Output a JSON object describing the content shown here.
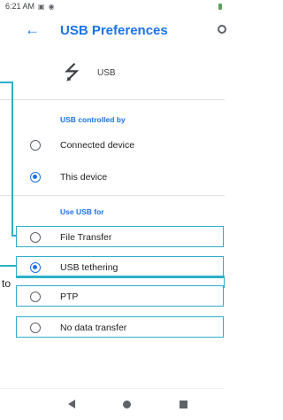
{
  "status": {
    "time": "6:21 AM"
  },
  "header": {
    "title": "USB Preferences"
  },
  "device": {
    "label": "USB"
  },
  "controlled": {
    "title": "USB controlled by",
    "options": [
      {
        "label": "Connected device",
        "checked": false
      },
      {
        "label": "This device",
        "checked": true
      }
    ]
  },
  "use_for": {
    "title": "Use USB for",
    "options": [
      {
        "label": "File Transfer",
        "checked": false
      },
      {
        "label": "USB tethering",
        "checked": true
      },
      {
        "label": "PTP",
        "checked": false
      },
      {
        "label": "No data transfer",
        "checked": false
      }
    ]
  },
  "annotation": {
    "text": "to"
  },
  "colors": {
    "accent": "#1a73e8",
    "highlight": "#2bb0c8"
  },
  "icons": {
    "back": "arrow-left-icon",
    "search": "search-icon",
    "usb": "usb-icon",
    "nav_back": "triangle-back-icon",
    "nav_home": "circle-home-icon",
    "nav_recent": "square-recents-icon"
  }
}
